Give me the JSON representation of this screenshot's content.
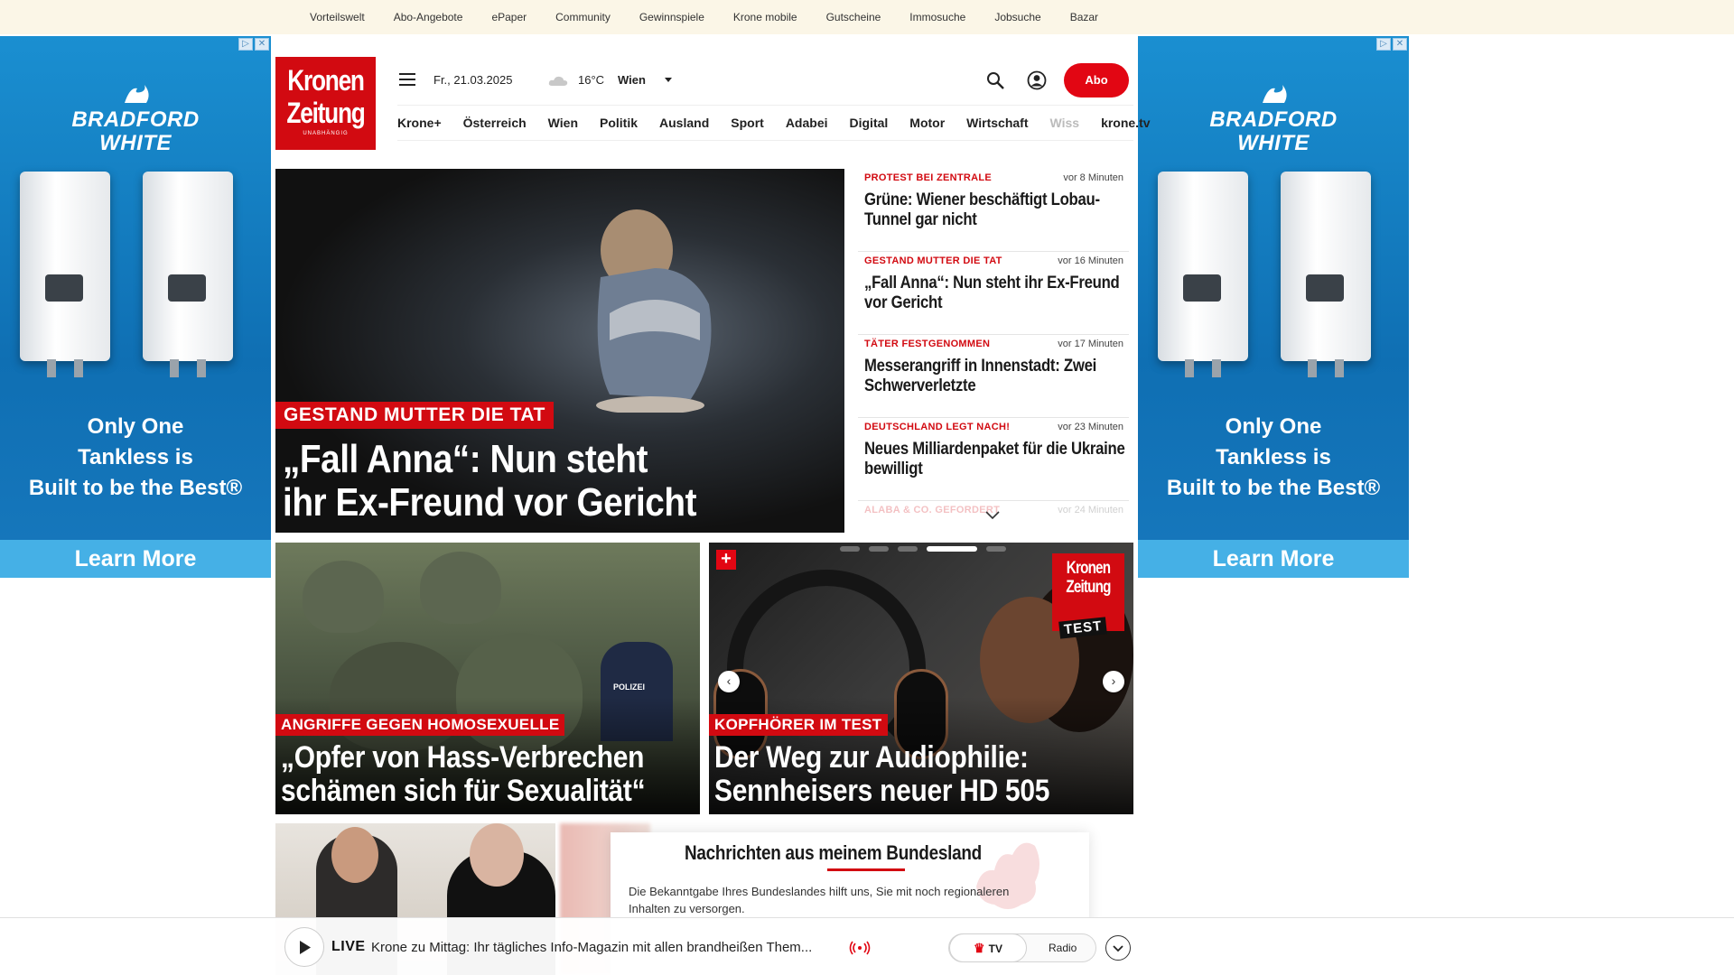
{
  "topbar": {
    "links": [
      "Vorteilswelt",
      "Abo-Angebote",
      "ePaper",
      "Community",
      "Gewinnspiele",
      "Krone mobile",
      "Gutscheine",
      "Immosuche",
      "Jobsuche",
      "Bazar"
    ]
  },
  "ad": {
    "brand_line1": "BRADFORD",
    "brand_line2": "WHITE",
    "slogan_line1": "Only One",
    "slogan_line2": "Tankless is",
    "slogan_line3": "Built to be the Best®",
    "cta": "Learn More"
  },
  "header": {
    "logo_line1": "Kronen",
    "logo_line2": "Zeitung",
    "logo_sub": "UNABHÄNGIG",
    "date": "Fr., 21.03.2025",
    "temperature": "16°C",
    "city": "Wien",
    "abo_label": "Abo"
  },
  "nav": {
    "items": [
      "Krone+",
      "Österreich",
      "Wien",
      "Politik",
      "Ausland",
      "Sport",
      "Adabei",
      "Digital",
      "Motor",
      "Wirtschaft"
    ],
    "truncated": "Wiss",
    "end_link": "krone.tv"
  },
  "hero": {
    "tag": "GESTAND MUTTER DIE TAT",
    "title_line1": "„Fall Anna“: Nun steht",
    "title_line2": "ihr Ex-Freund vor Gericht"
  },
  "ticker": [
    {
      "kicker": "PROTEST BEI ZENTRALE",
      "time": "vor 8 Minuten",
      "headline": "Grüne: Wiener beschäftigt Lobau-Tunnel gar nicht"
    },
    {
      "kicker": "GESTAND MUTTER DIE TAT",
      "time": "vor 16 Minuten",
      "headline": "„Fall Anna“: Nun steht ihr Ex-Freund vor Gericht"
    },
    {
      "kicker": "TÄTER FESTGENOMMEN",
      "time": "vor 17 Minuten",
      "headline": "Messerangriff in Innenstadt: Zwei Schwerverletzte"
    },
    {
      "kicker": "DEUTSCHLAND LEGT NACH!",
      "time": "vor 23 Minuten",
      "headline": "Neues Milliardenpaket für die Ukraine bewilligt"
    },
    {
      "kicker": "ALABA & CO. GEFORDERT",
      "time": "vor 24 Minuten",
      "headline": ""
    }
  ],
  "cards": {
    "left": {
      "tag": "ANGRIFFE GEGEN HOMOSEXUELLE",
      "title_line1": "„Opfer von Hass-Verbrechen",
      "title_line2": "schämen sich für Sexualität“",
      "badge": "POLIZEI"
    },
    "right": {
      "tag": "KOPFHÖRER IM TEST",
      "title_line1": "Der Weg zur Audiophilie:",
      "title_line2": "Sennheisers neuer HD 505",
      "logo_line1": "Kronen",
      "logo_line2": "Zeitung",
      "logo_test": "TEST",
      "plus": "+",
      "active_slide": 4,
      "slide_count": 6
    }
  },
  "overlay": {
    "title": "Nachrichten aus meinem Bundesland",
    "text": "Die Bekanntgabe Ihres Bundeslandes hilft uns, Sie mit noch regionaleren Inhalten zu versorgen."
  },
  "player": {
    "live_label": "LIVE",
    "description": "Krone zu Mittag: Ihr tägliches Info-Magazin mit allen brandheißen Them...",
    "tv_label": "TV",
    "radio_label": "Radio"
  },
  "colors": {
    "brand_red": "#d20a11",
    "abo_red": "#e20613",
    "topbar_bg": "#fbf6e7",
    "ad_blue": "#1a8fd1"
  }
}
